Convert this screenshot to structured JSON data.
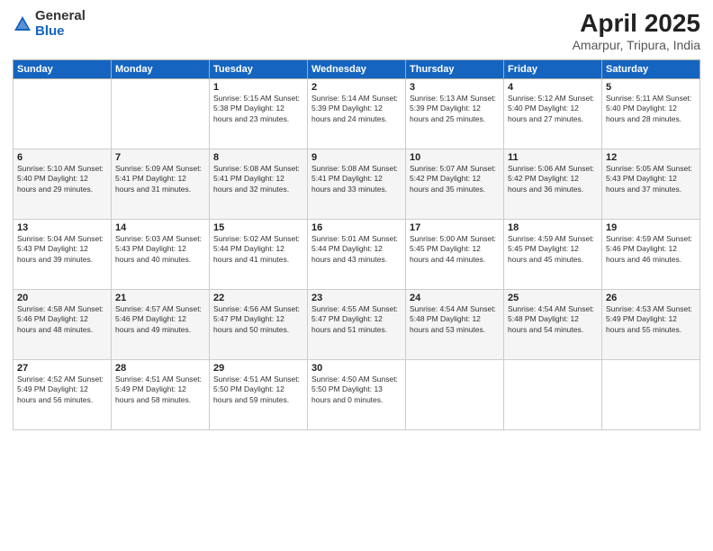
{
  "logo": {
    "general": "General",
    "blue": "Blue"
  },
  "title": "April 2025",
  "location": "Amarpur, Tripura, India",
  "weekdays": [
    "Sunday",
    "Monday",
    "Tuesday",
    "Wednesday",
    "Thursday",
    "Friday",
    "Saturday"
  ],
  "weeks": [
    [
      {
        "day": "",
        "info": ""
      },
      {
        "day": "",
        "info": ""
      },
      {
        "day": "1",
        "info": "Sunrise: 5:15 AM\nSunset: 5:38 PM\nDaylight: 12 hours\nand 23 minutes."
      },
      {
        "day": "2",
        "info": "Sunrise: 5:14 AM\nSunset: 5:39 PM\nDaylight: 12 hours\nand 24 minutes."
      },
      {
        "day": "3",
        "info": "Sunrise: 5:13 AM\nSunset: 5:39 PM\nDaylight: 12 hours\nand 25 minutes."
      },
      {
        "day": "4",
        "info": "Sunrise: 5:12 AM\nSunset: 5:40 PM\nDaylight: 12 hours\nand 27 minutes."
      },
      {
        "day": "5",
        "info": "Sunrise: 5:11 AM\nSunset: 5:40 PM\nDaylight: 12 hours\nand 28 minutes."
      }
    ],
    [
      {
        "day": "6",
        "info": "Sunrise: 5:10 AM\nSunset: 5:40 PM\nDaylight: 12 hours\nand 29 minutes."
      },
      {
        "day": "7",
        "info": "Sunrise: 5:09 AM\nSunset: 5:41 PM\nDaylight: 12 hours\nand 31 minutes."
      },
      {
        "day": "8",
        "info": "Sunrise: 5:08 AM\nSunset: 5:41 PM\nDaylight: 12 hours\nand 32 minutes."
      },
      {
        "day": "9",
        "info": "Sunrise: 5:08 AM\nSunset: 5:41 PM\nDaylight: 12 hours\nand 33 minutes."
      },
      {
        "day": "10",
        "info": "Sunrise: 5:07 AM\nSunset: 5:42 PM\nDaylight: 12 hours\nand 35 minutes."
      },
      {
        "day": "11",
        "info": "Sunrise: 5:06 AM\nSunset: 5:42 PM\nDaylight: 12 hours\nand 36 minutes."
      },
      {
        "day": "12",
        "info": "Sunrise: 5:05 AM\nSunset: 5:43 PM\nDaylight: 12 hours\nand 37 minutes."
      }
    ],
    [
      {
        "day": "13",
        "info": "Sunrise: 5:04 AM\nSunset: 5:43 PM\nDaylight: 12 hours\nand 39 minutes."
      },
      {
        "day": "14",
        "info": "Sunrise: 5:03 AM\nSunset: 5:43 PM\nDaylight: 12 hours\nand 40 minutes."
      },
      {
        "day": "15",
        "info": "Sunrise: 5:02 AM\nSunset: 5:44 PM\nDaylight: 12 hours\nand 41 minutes."
      },
      {
        "day": "16",
        "info": "Sunrise: 5:01 AM\nSunset: 5:44 PM\nDaylight: 12 hours\nand 43 minutes."
      },
      {
        "day": "17",
        "info": "Sunrise: 5:00 AM\nSunset: 5:45 PM\nDaylight: 12 hours\nand 44 minutes."
      },
      {
        "day": "18",
        "info": "Sunrise: 4:59 AM\nSunset: 5:45 PM\nDaylight: 12 hours\nand 45 minutes."
      },
      {
        "day": "19",
        "info": "Sunrise: 4:59 AM\nSunset: 5:46 PM\nDaylight: 12 hours\nand 46 minutes."
      }
    ],
    [
      {
        "day": "20",
        "info": "Sunrise: 4:58 AM\nSunset: 5:46 PM\nDaylight: 12 hours\nand 48 minutes."
      },
      {
        "day": "21",
        "info": "Sunrise: 4:57 AM\nSunset: 5:46 PM\nDaylight: 12 hours\nand 49 minutes."
      },
      {
        "day": "22",
        "info": "Sunrise: 4:56 AM\nSunset: 5:47 PM\nDaylight: 12 hours\nand 50 minutes."
      },
      {
        "day": "23",
        "info": "Sunrise: 4:55 AM\nSunset: 5:47 PM\nDaylight: 12 hours\nand 51 minutes."
      },
      {
        "day": "24",
        "info": "Sunrise: 4:54 AM\nSunset: 5:48 PM\nDaylight: 12 hours\nand 53 minutes."
      },
      {
        "day": "25",
        "info": "Sunrise: 4:54 AM\nSunset: 5:48 PM\nDaylight: 12 hours\nand 54 minutes."
      },
      {
        "day": "26",
        "info": "Sunrise: 4:53 AM\nSunset: 5:49 PM\nDaylight: 12 hours\nand 55 minutes."
      }
    ],
    [
      {
        "day": "27",
        "info": "Sunrise: 4:52 AM\nSunset: 5:49 PM\nDaylight: 12 hours\nand 56 minutes."
      },
      {
        "day": "28",
        "info": "Sunrise: 4:51 AM\nSunset: 5:49 PM\nDaylight: 12 hours\nand 58 minutes."
      },
      {
        "day": "29",
        "info": "Sunrise: 4:51 AM\nSunset: 5:50 PM\nDaylight: 12 hours\nand 59 minutes."
      },
      {
        "day": "30",
        "info": "Sunrise: 4:50 AM\nSunset: 5:50 PM\nDaylight: 13 hours\nand 0 minutes."
      },
      {
        "day": "",
        "info": ""
      },
      {
        "day": "",
        "info": ""
      },
      {
        "day": "",
        "info": ""
      }
    ]
  ]
}
